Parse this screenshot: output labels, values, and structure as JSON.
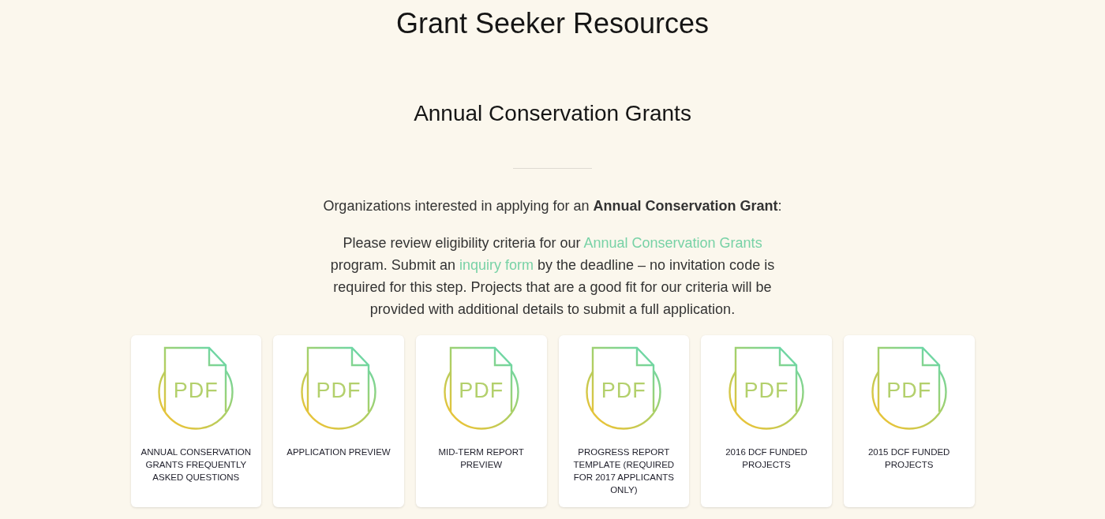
{
  "page_title": "Grant Seeker Resources",
  "section": {
    "title": "Annual Conservation Grants",
    "intro": "Organizations interested in applying for an **Annual Conservation Grant**:",
    "body": [
      {
        "kind": "text",
        "text": "Please review eligibility criteria for our "
      },
      {
        "kind": "link",
        "text": "Annual Conservation Grants"
      },
      {
        "kind": "text",
        "text": " program. Submit an "
      },
      {
        "kind": "link",
        "text": "inquiry form"
      },
      {
        "kind": "text",
        "text": " by the deadline – no invitation code is required for this step. Projects that are a good fit for our criteria will be provided with additional details to submit a full application."
      }
    ],
    "resources": [
      {
        "file_type": "PDF",
        "title": "ANNUAL CONSERVATION GRANTS FREQUENTLY ASKED QUESTIONS"
      },
      {
        "file_type": "PDF",
        "title": "APPLICATION PREVIEW"
      },
      {
        "file_type": "PDF",
        "title": "MID-TERM REPORT PREVIEW"
      },
      {
        "file_type": "PDF",
        "title": "PROGRESS REPORT TEMPLATE (REQUIRED FOR 2017 APPLICANTS ONLY)"
      },
      {
        "file_type": "PDF",
        "title": "2016 DCF FUNDED PROJECTS"
      },
      {
        "file_type": "PDF",
        "title": "2015 DCF FUNDED PROJECTS"
      }
    ]
  }
}
